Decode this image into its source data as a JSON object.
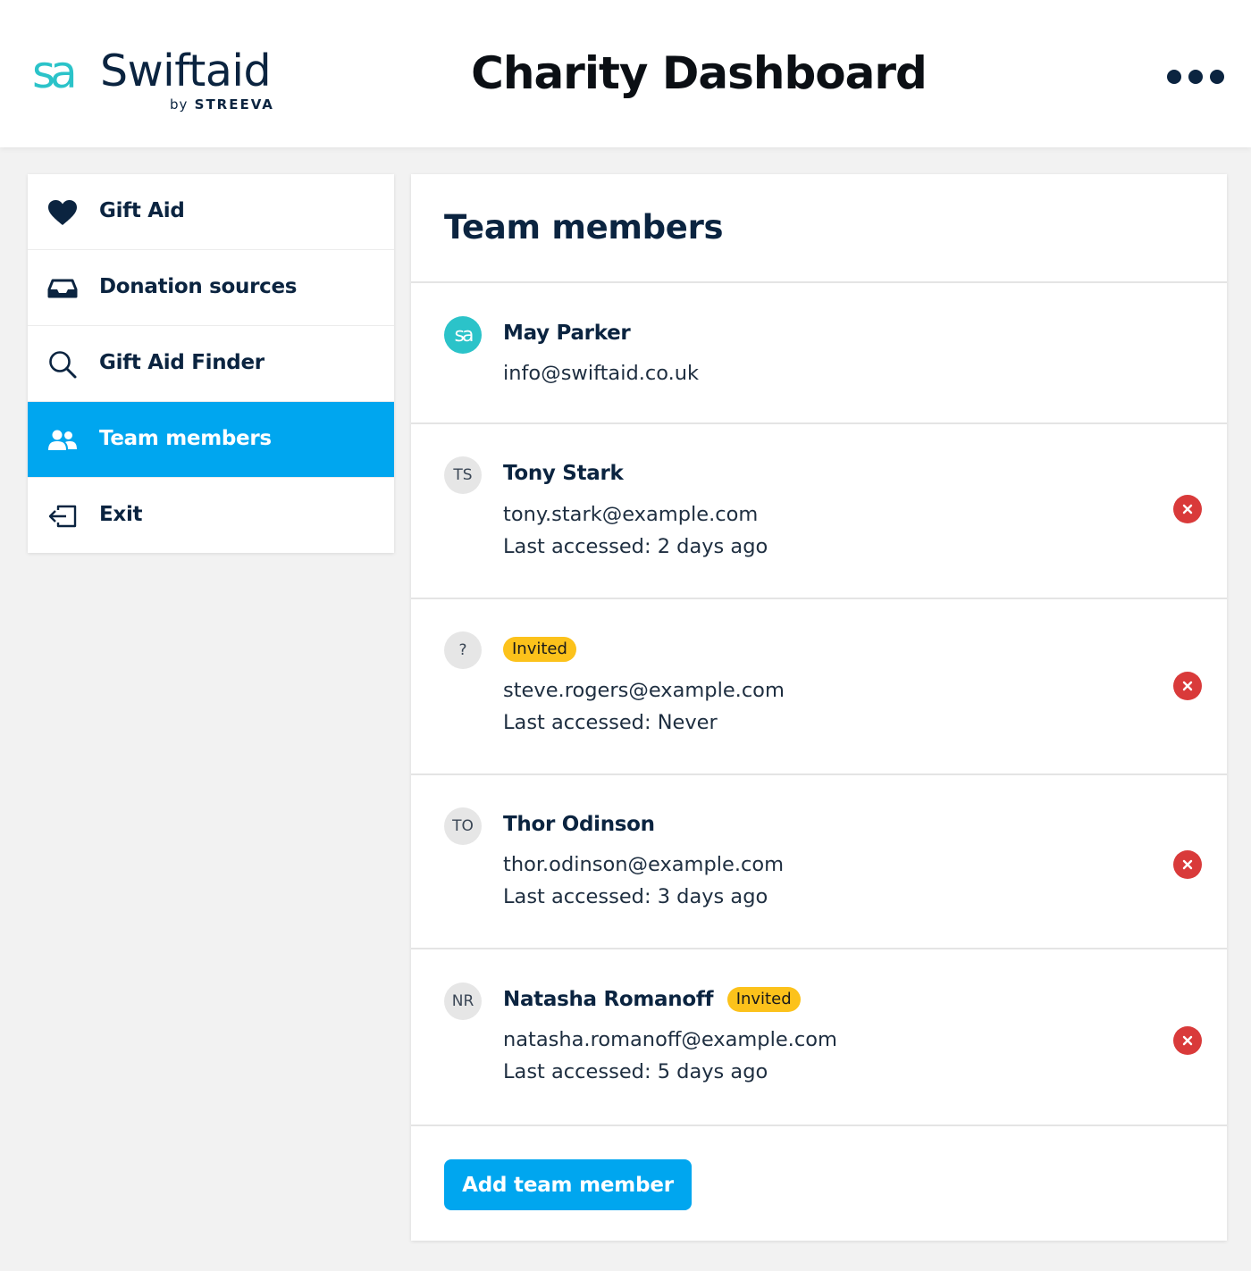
{
  "header": {
    "logo_mark": "sa",
    "logo_name": "Swiftaid",
    "logo_by": "by",
    "logo_company": "STREEVA",
    "title": "Charity Dashboard",
    "menu_icon": "more-horizontal-icon"
  },
  "sidebar": {
    "items": [
      {
        "label": "Gift Aid",
        "icon": "heart-icon",
        "active": false
      },
      {
        "label": "Donation sources",
        "icon": "inbox-tray-icon",
        "active": false
      },
      {
        "label": "Gift Aid Finder",
        "icon": "search-icon",
        "active": false
      },
      {
        "label": "Team members",
        "icon": "users-icon",
        "active": true
      },
      {
        "label": "Exit",
        "icon": "exit-icon",
        "active": false
      }
    ]
  },
  "main": {
    "title": "Team members",
    "members": [
      {
        "avatar": "sa",
        "name": "May Parker",
        "email": "info@swiftaid.co.uk",
        "last_accessed": "",
        "invited": false,
        "removable": false
      },
      {
        "avatar": "TS",
        "name": "Tony Stark",
        "email": "tony.stark@example.com",
        "last_accessed": "Last accessed: 2 days ago",
        "invited": false,
        "removable": true
      },
      {
        "avatar": "?",
        "name": "",
        "email": "steve.rogers@example.com",
        "last_accessed": "Last accessed: Never",
        "invited": true,
        "removable": true
      },
      {
        "avatar": "TO",
        "name": "Thor Odinson",
        "email": "thor.odinson@example.com",
        "last_accessed": "Last accessed: 3 days ago",
        "invited": false,
        "removable": true
      },
      {
        "avatar": "NR",
        "name": "Natasha Romanoff",
        "email": "natasha.romanoff@example.com",
        "last_accessed": "Last accessed: 5 days ago",
        "invited": true,
        "removable": true
      }
    ],
    "invited_label": "Invited",
    "add_button": "Add team member"
  },
  "colors": {
    "brand_teal": "#2bc3c9",
    "accent_blue": "#00a6ef",
    "navy": "#0b2440",
    "badge_yellow": "#fcc21b",
    "remove_red": "#d93a3a"
  }
}
